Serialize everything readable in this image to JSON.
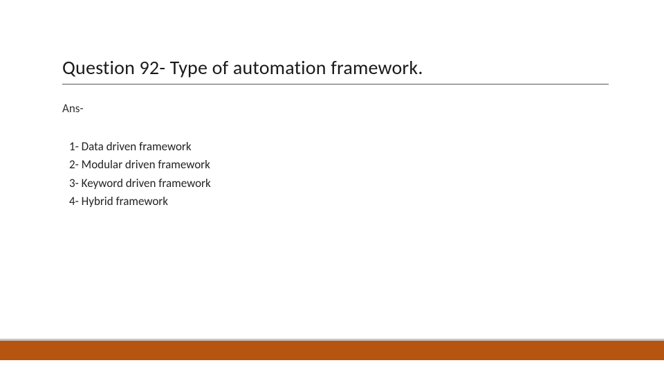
{
  "slide": {
    "title": "Question 92- Type of automation framework.",
    "answer_label": "Ans-",
    "items": [
      "1- Data driven framework",
      "2- Modular driven framework",
      "3- Keyword driven framework",
      "4- Hybrid framework"
    ]
  },
  "colors": {
    "accent_bar": "#b5550f"
  }
}
